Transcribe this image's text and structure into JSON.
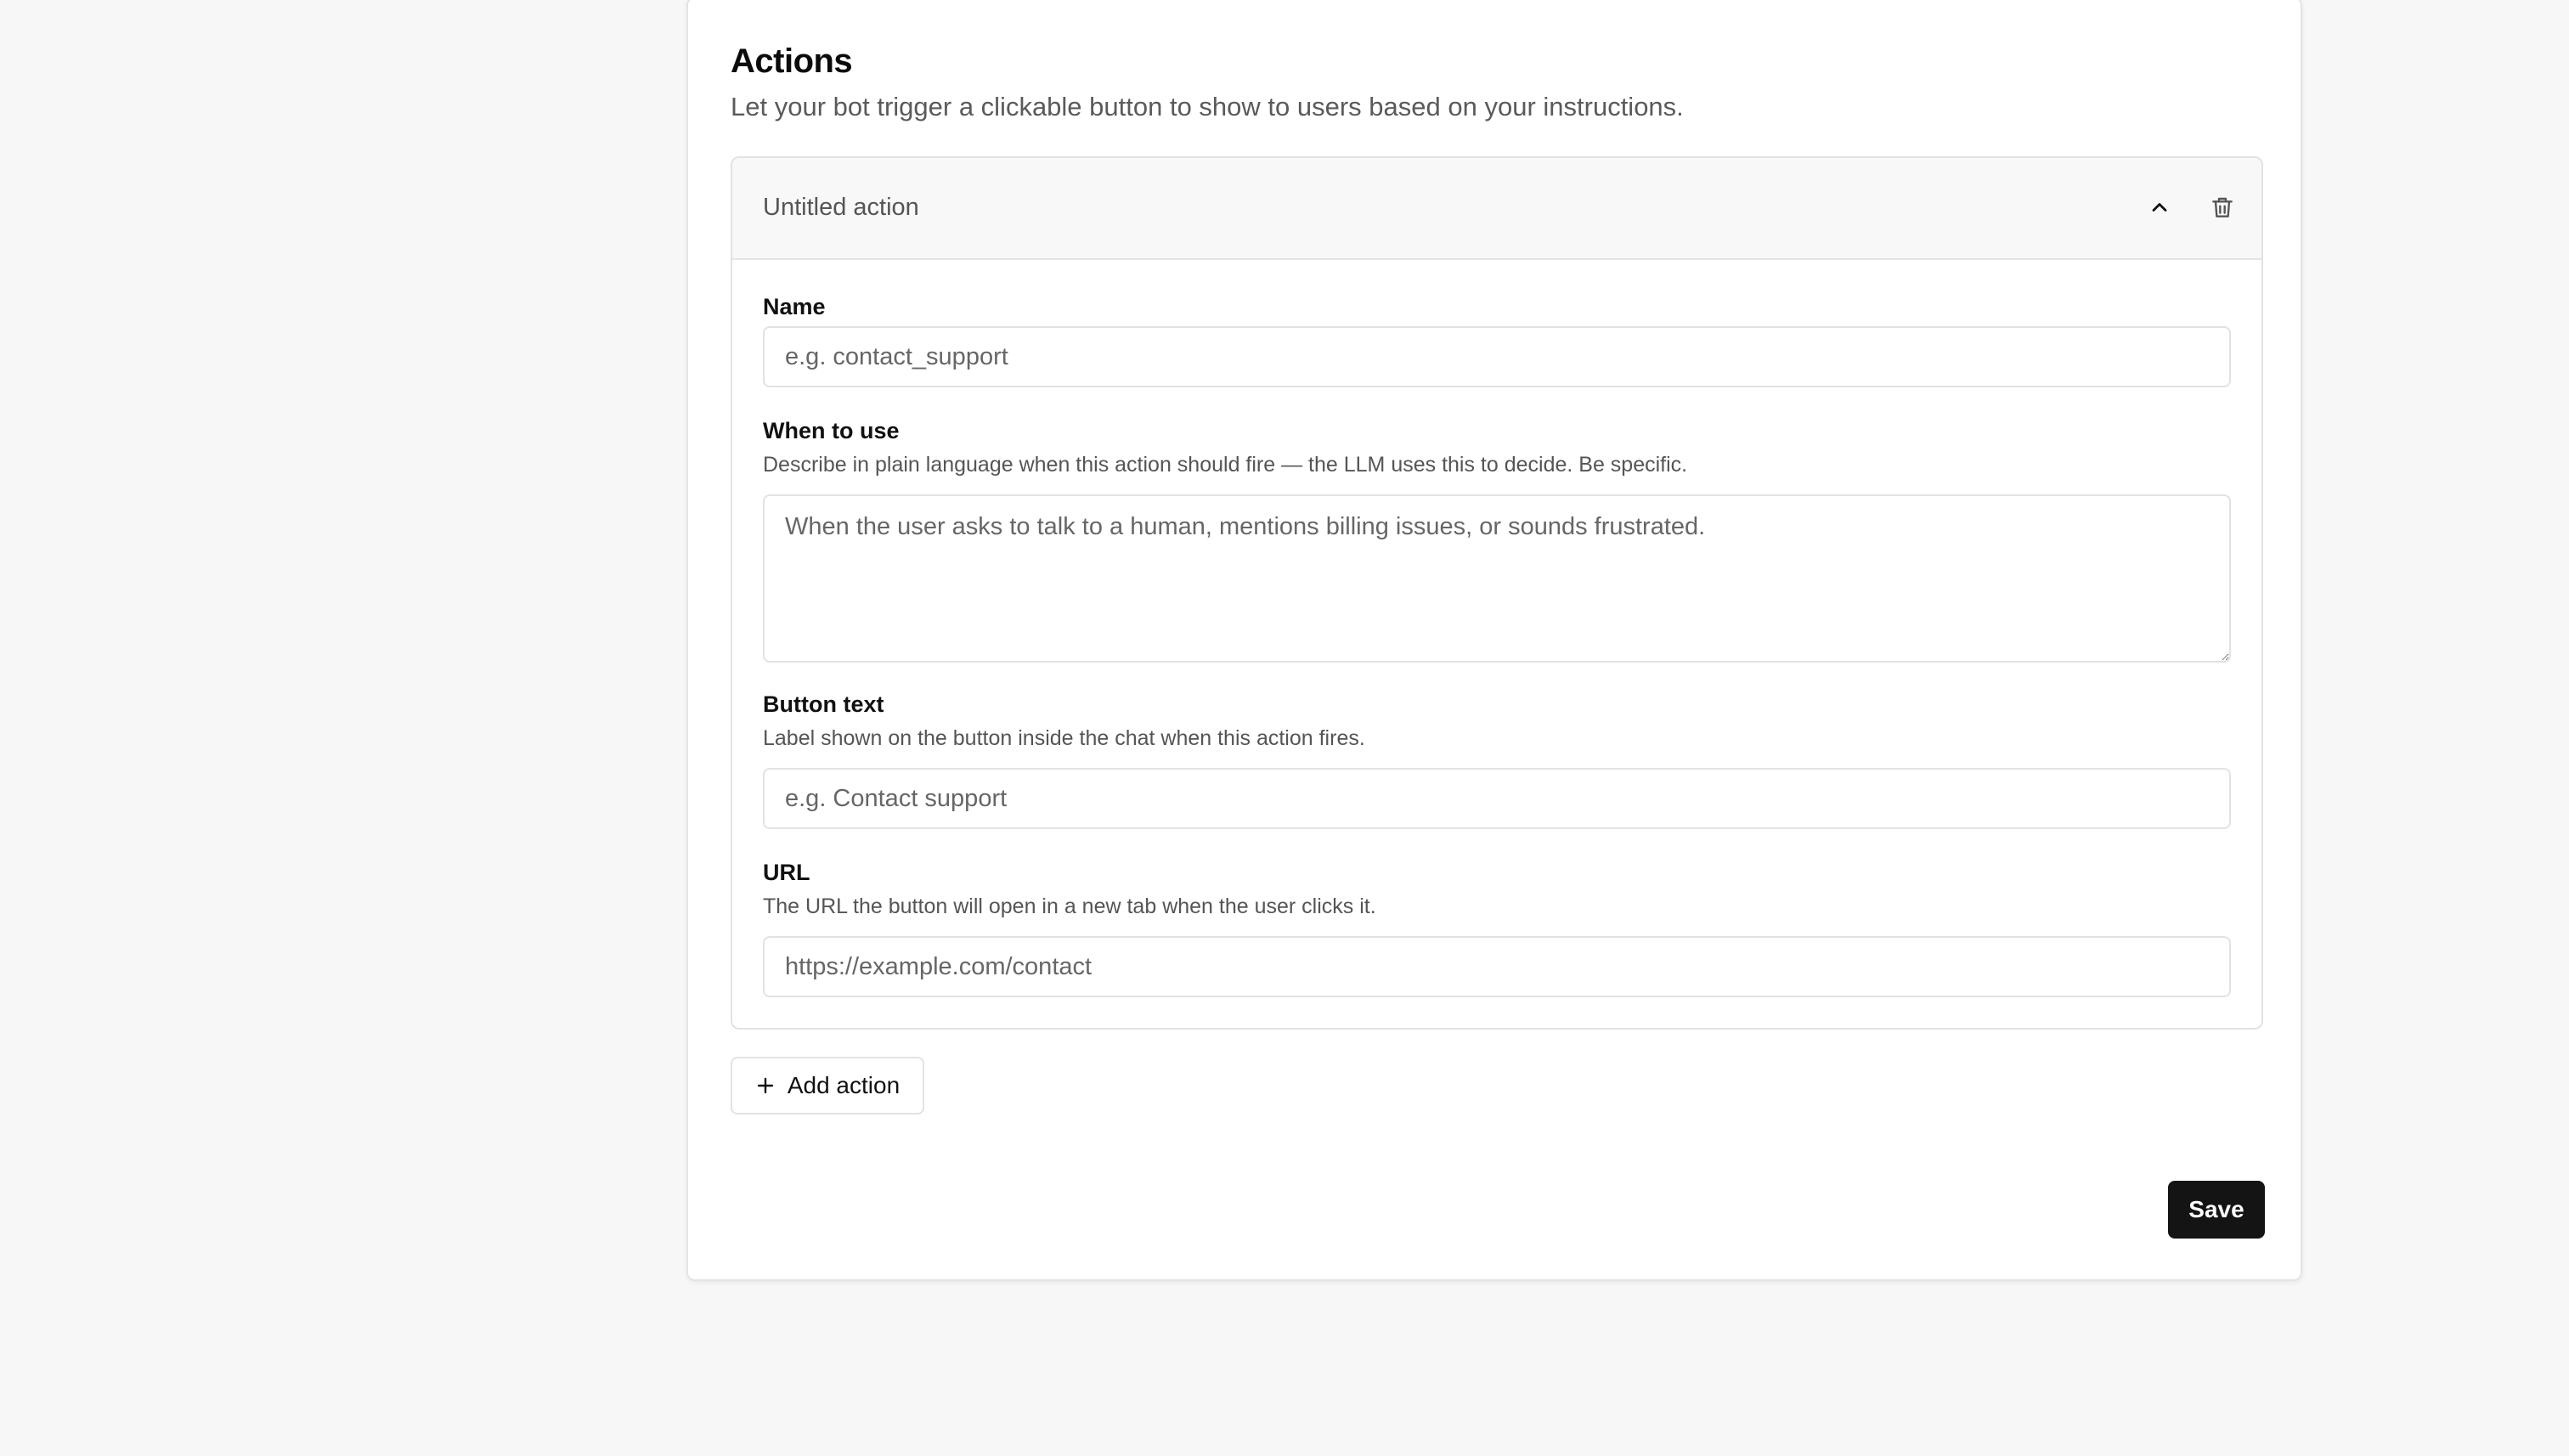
{
  "section": {
    "title": "Actions",
    "description": "Let your bot trigger a clickable button to show to users based on your instructions."
  },
  "action": {
    "title": "Untitled action",
    "collapse_icon": "chevron-up-icon",
    "delete_icon": "trash-icon",
    "fields": {
      "name": {
        "label": "Name",
        "value": "",
        "placeholder": "e.g. contact_support"
      },
      "when_to_use": {
        "label": "When to use",
        "help": "Describe in plain language when this action should fire — the LLM uses this to decide. Be specific.",
        "value": "",
        "placeholder": "When the user asks to talk to a human, mentions billing issues, or sounds frustrated."
      },
      "button_text": {
        "label": "Button text",
        "help": "Label shown on the button inside the chat when this action fires.",
        "value": "",
        "placeholder": "e.g. Contact support"
      },
      "url": {
        "label": "URL",
        "help": "The URL the button will open in a new tab when the user clicks it.",
        "value": "",
        "placeholder": "https://example.com/contact"
      }
    }
  },
  "buttons": {
    "add_action": "Add action",
    "add_icon": "plus-icon",
    "save": "Save"
  },
  "colors": {
    "page_bg": "#f7f7f7",
    "card_bg": "#ffffff",
    "border": "#e2e2e2",
    "header_bg": "#f8f8f8",
    "primary_button_bg": "#141414",
    "primary_button_text": "#ffffff",
    "muted_text": "#555555"
  }
}
